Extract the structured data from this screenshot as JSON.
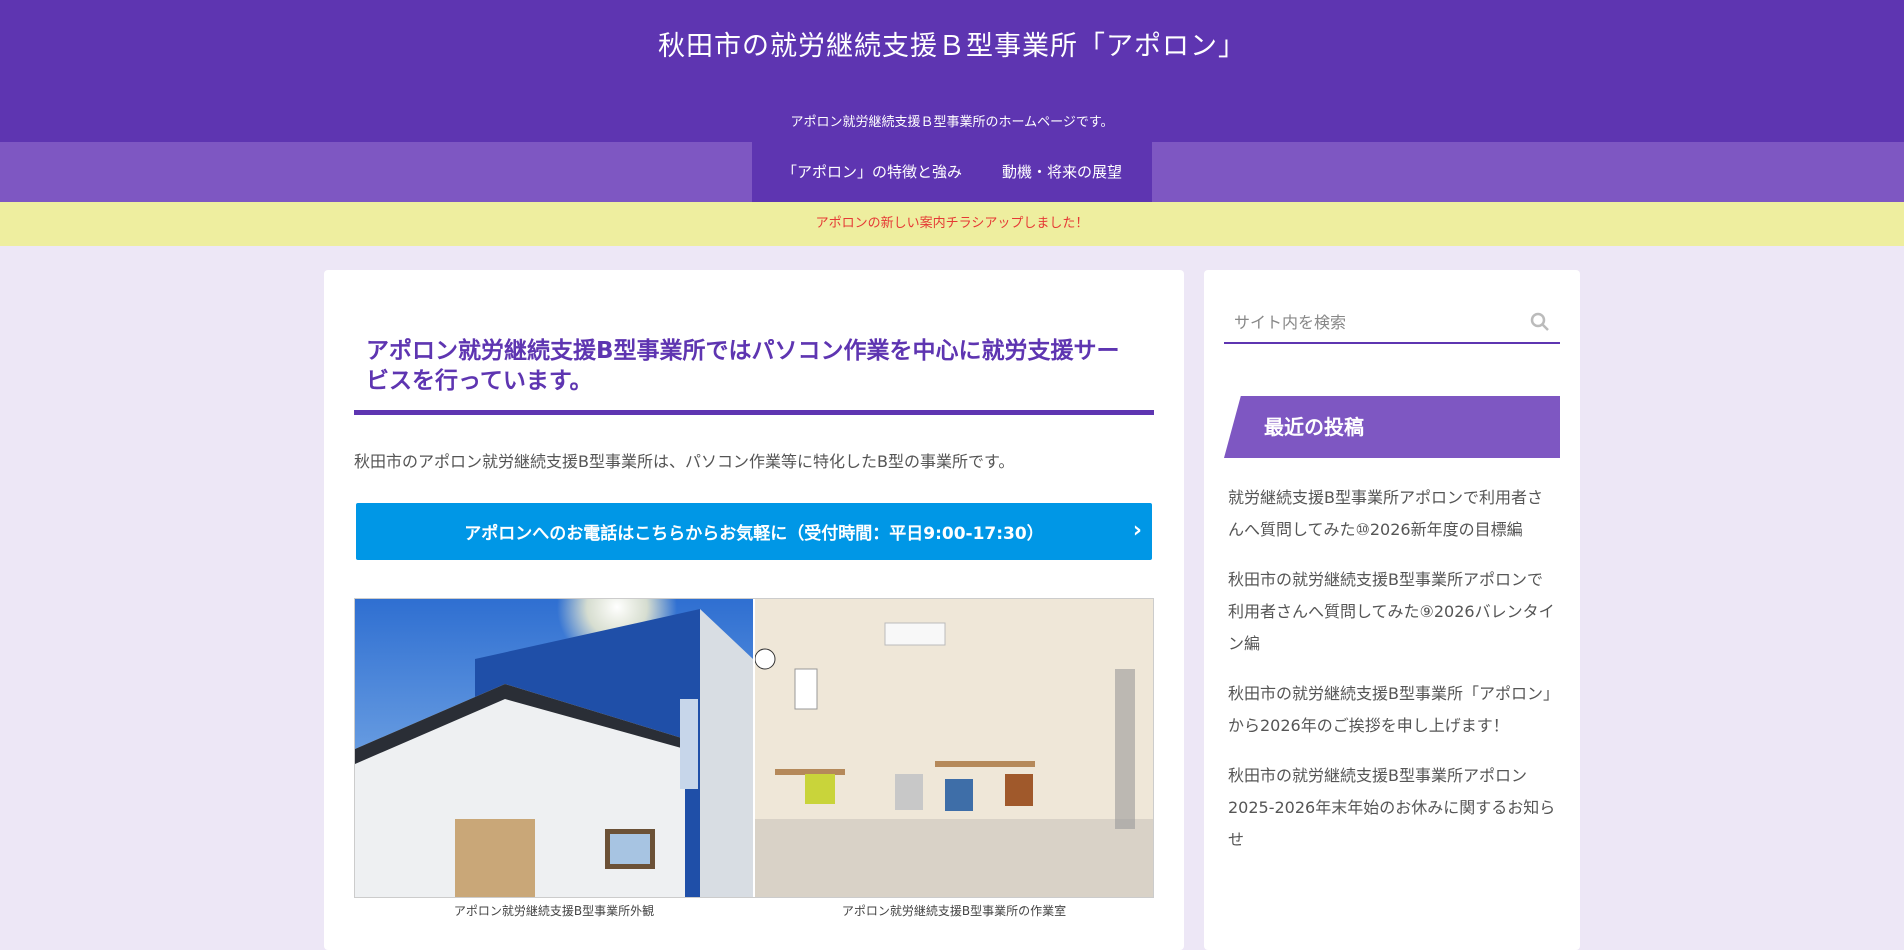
{
  "header": {
    "site_title": "秋田市の就労継続支援Ｂ型事業所「アポロン」",
    "site_description": "アポロン就労継続支援Ｂ型事業所のホームページです。"
  },
  "nav": {
    "items": [
      {
        "label": "「アポロン」の特徴と強み"
      },
      {
        "label": "動機・将来の展望"
      }
    ]
  },
  "notice": {
    "text": "アポロンの新しい案内チラシアップしました！"
  },
  "main": {
    "title": "アポロン就労継続支援B型事業所ではパソコン作業を中心に就労支援サービスを行っています。",
    "intro": "秋田市のアポロン就労継続支援B型事業所は、パソコン作業等に特化したB型の事業所です。",
    "cta_label": "アポロンへのお電話はこちらからお気軽に（受付時間：平日9:00-17:30）",
    "captions": [
      "アポロン就労継続支援B型事業所外観",
      "アポロン就労継続支援B型事業所の作業室"
    ]
  },
  "sidebar": {
    "search_placeholder": "サイト内を検索",
    "widget_title": "最近の投稿",
    "recent_posts": [
      "就労継続支援B型事業所アポロンで利用者さんへ質問してみた⑩2026新年度の目標編",
      "秋田市の就労継続支援B型事業所アポロンで利用者さんへ質問してみた⑨2026バレンタイン編",
      "秋田市の就労継続支援B型事業所「アポロン」から2026年のご挨拶を申し上げます！",
      "秋田市の就労継続支援B型事業所アポロン2025-2026年末年始のお休みに関するお知らせ"
    ]
  },
  "colors": {
    "header": "#5e35b1",
    "nav": "#7e57c2",
    "notice_bg": "#eeee9f",
    "notice_text": "#e53935",
    "cta": "#0097e6",
    "page_bg": "#ede7f6"
  }
}
